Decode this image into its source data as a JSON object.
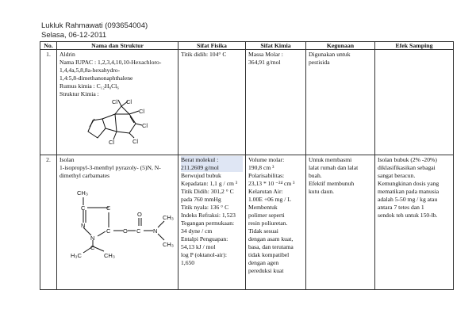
{
  "header": {
    "name": "Lukluk Rahmawati (093654004)",
    "date": "Selasa, 06-12-2011"
  },
  "columns": [
    "No.",
    "Nama dan Struktur",
    "Sifat Fisika",
    "Sifat Kimia",
    "Kegunaan",
    "Efek Samping"
  ],
  "rows": [
    {
      "no": "1.",
      "name_lines": [
        "Aldrin",
        "Nama IUPAC : 1,2,3,4,10,10-Hexachloro-",
        "1,4,4a,5,8,8a-hexahydro-",
        "1,4:5,8-dimethanonaphthalene",
        "Rumus kimia : C₁₂H₈Cl₆",
        "Struktur Kimia :"
      ],
      "structure_labels": [
        "Cl",
        "Cl",
        "Cl",
        "Cl",
        "Cl",
        "Cl"
      ],
      "fisika": [
        "Titik didih: 104° C"
      ],
      "kimia": [
        "Massa Molar :",
        "364,91 g/mol"
      ],
      "kegunaan": [
        "Digunakan untuk",
        "pestisida"
      ],
      "efek": []
    },
    {
      "no": "2.",
      "name_lines": [
        "Isolan",
        "1-isopropyl-3-menthyl pyrazoly- (5)N, N-",
        "dimethyl carbamates"
      ],
      "structure_labels": [
        "CH₃",
        "C",
        "C",
        "N",
        "C",
        "O",
        "C",
        "O",
        "N",
        "CH₃",
        "CH₃",
        "N",
        "C",
        "H₃C",
        "CH₃"
      ],
      "fisika_highlight": [
        "Berat molekul :",
        "211.2609 g/mol"
      ],
      "fisika": [
        "Berwujud bubuk",
        "Kepadatan: 1,1 g / cm ³",
        "Titik Didih: 301,2 ° C",
        "pada 760 mmHg",
        "Titik nyala: 136 ° C",
        "Indeks Refraksi: 1,523",
        "Tegangan permukaan:",
        "34 dyne / cm",
        "Entalpi Penguapan:",
        "54,13 kJ / mol",
        "log P (oktanol-air):",
        "1,650"
      ],
      "kimia": [
        "Volume molar:",
        "190,8 cm ³",
        "Polarisabilitas:",
        "23,13 * 10 ⁻²⁴ cm ³",
        "Kelarutan Air:",
        "1.00E +06 mg / L",
        "Membentuk",
        "polimer seperti",
        "resin poliuretan.",
        "Tidak sesuai",
        "dengan asam kuat,",
        "basa, dan terutama",
        "tidak kompatibel",
        "dengan agen",
        "pereduksi kuat"
      ],
      "kegunaan": [
        "Untuk membasmi",
        "lalat rumah dan lalat",
        "buah.",
        "Efektif membunuh",
        "kutu daun."
      ],
      "efek": [
        "Isolan bubuk (2% -20%)",
        "diklasifikasikan sebagai",
        "sangat beracun.",
        "Kemungkinan dosis yang",
        "mematikan pada manusia",
        "adalah 5-50 mg / kg atau",
        "antara 7 tetes dan 1",
        "sendok teh untuk 150-lb."
      ]
    }
  ]
}
